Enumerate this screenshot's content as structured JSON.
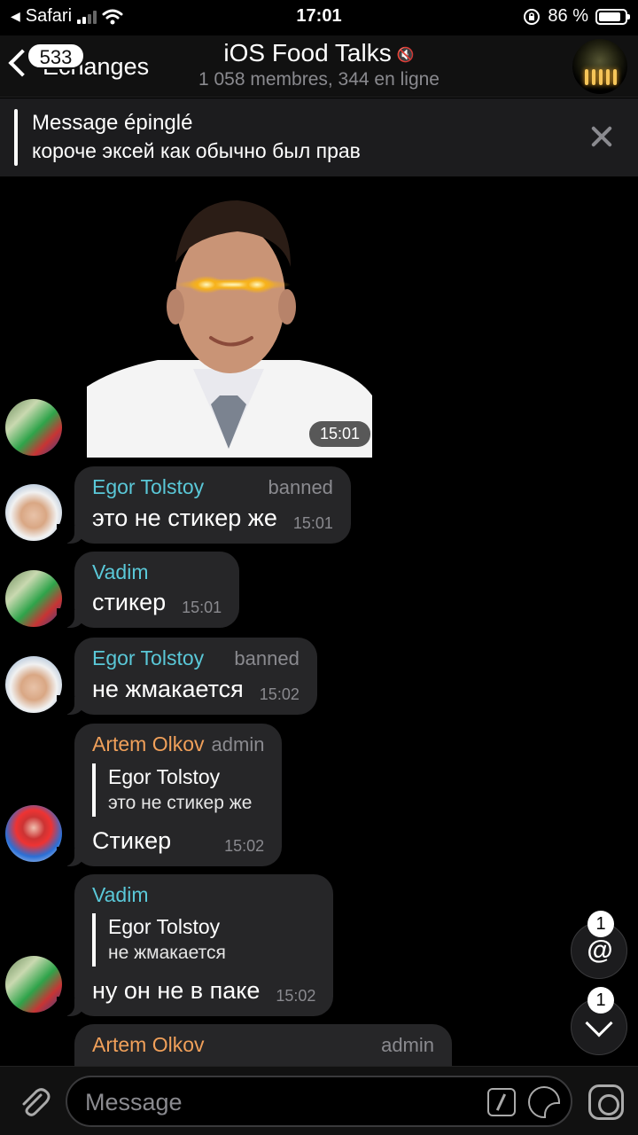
{
  "status_bar": {
    "back_app": "Safari",
    "time": "17:01",
    "battery": "86 %",
    "battery_level": 0.86
  },
  "nav": {
    "back_label": "Échanges",
    "unread_badge": "533",
    "title": "iOS Food Talks",
    "subtitle": "1 058 membres, 344 en ligne"
  },
  "pinned": {
    "heading": "Message épinglé",
    "text": "короче эксей как обычно был прав"
  },
  "sticker": {
    "time": "15:01"
  },
  "messages": [
    {
      "author": "Egor Tolstoy",
      "role": "banned",
      "text": "это не стикер же",
      "time": "15:01"
    },
    {
      "author": "Vadim",
      "text": "стикер",
      "time": "15:01"
    },
    {
      "author": "Egor Tolstoy",
      "role": "banned",
      "text": "не жмакается",
      "time": "15:02"
    },
    {
      "author": "Artem Olkov",
      "role": "admin",
      "reply_author": "Egor Tolstoy",
      "reply_text": "это не стикер же",
      "text": "Стикер",
      "time": "15:02"
    },
    {
      "author": "Vadim",
      "reply_author": "Egor Tolstoy",
      "reply_text": "не жмакается",
      "text": "ну он не в паке",
      "time": "15:02"
    },
    {
      "author": "Artem Olkov",
      "role": "admin"
    }
  ],
  "fabs": {
    "mentions_count": "1",
    "mention_symbol": "@",
    "down_count": "1"
  },
  "input": {
    "placeholder": "Message"
  },
  "colors": {
    "name_cyan": "#5ac8d8",
    "name_orange": "#f0a05a",
    "bubble": "#262628"
  }
}
